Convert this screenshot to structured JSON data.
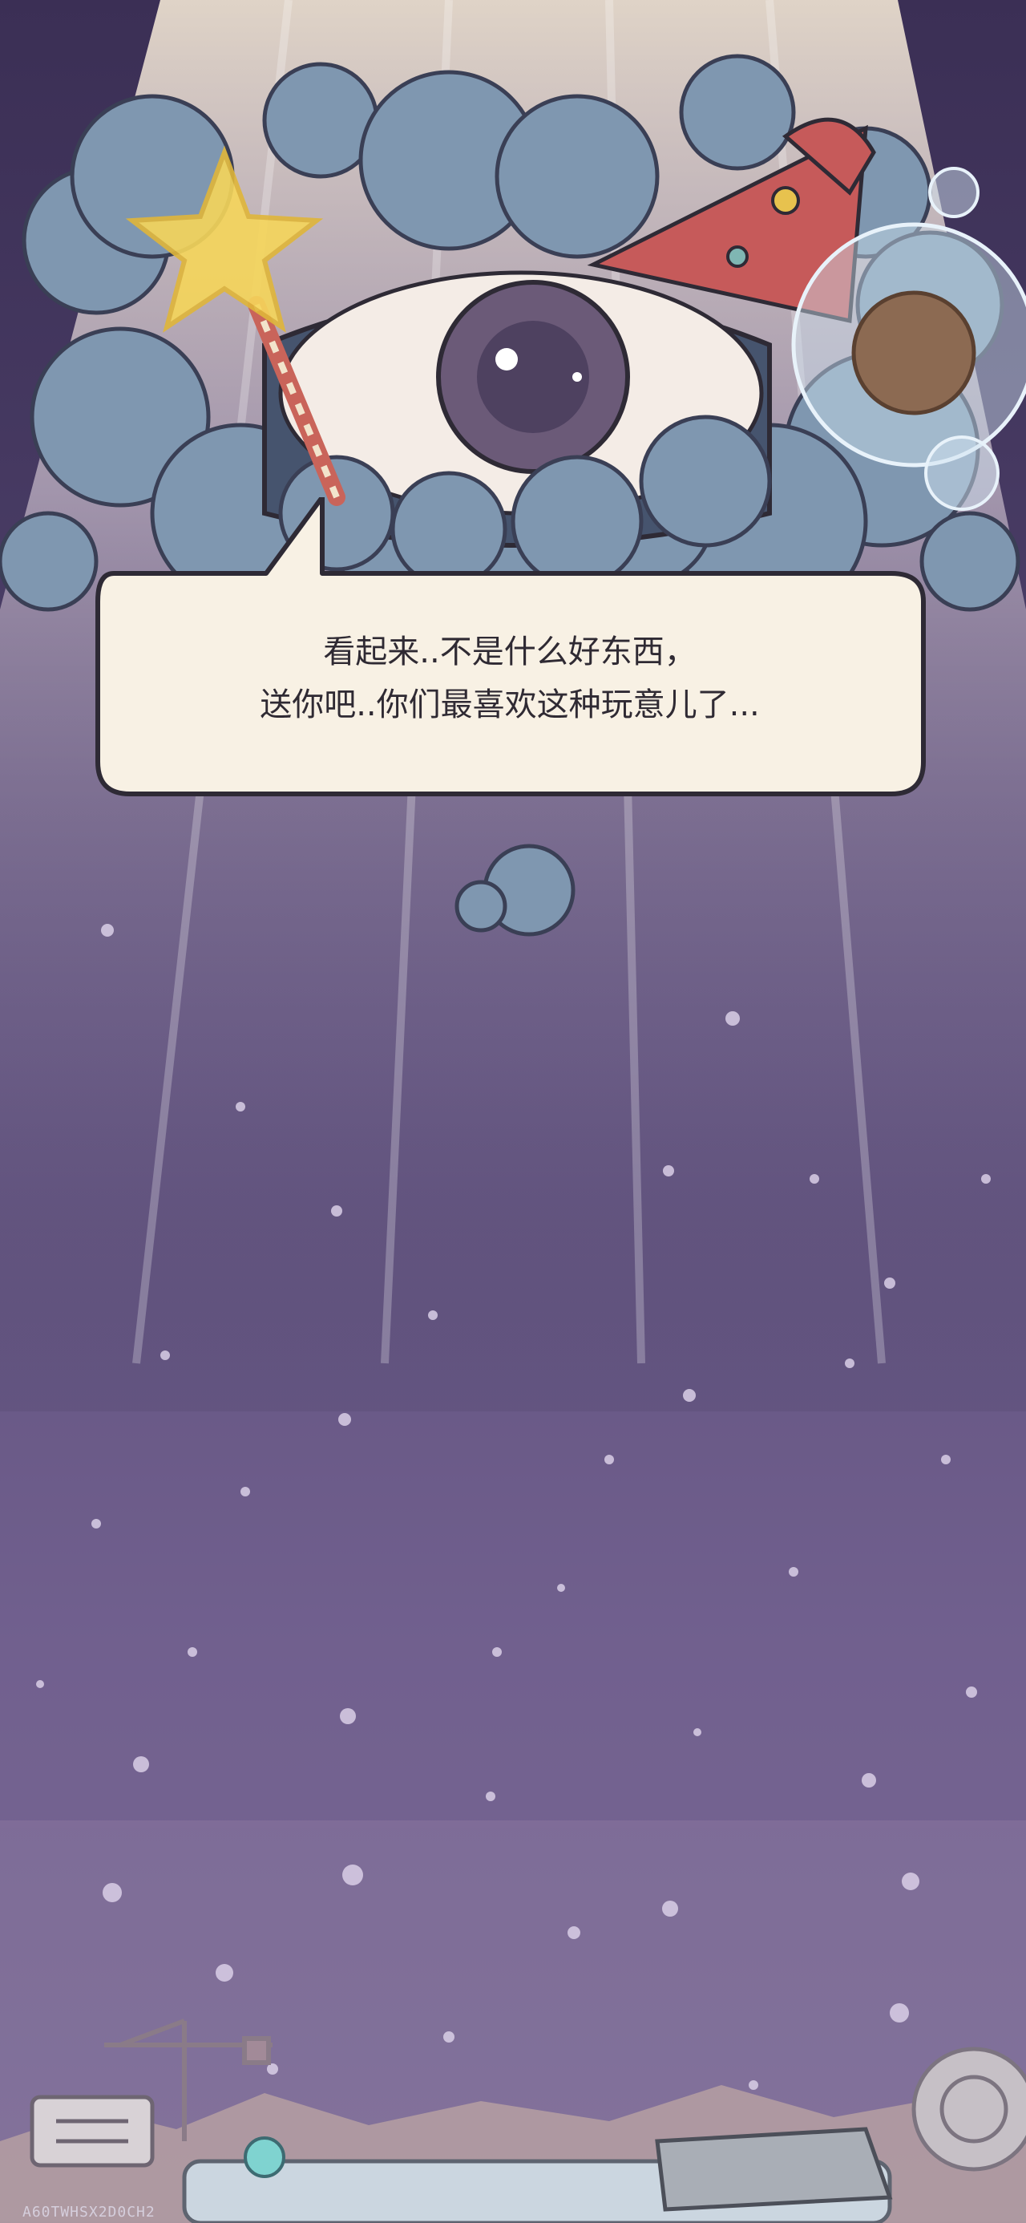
{
  "dialogue": {
    "line1": "看起来..不是什么好东西，",
    "line2": "送你吧..你们最喜欢这种玩意儿了..."
  },
  "watermark": "A60TWHSX2D0CH2",
  "colors": {
    "sky_top": "#3b2f55",
    "sky_bottom": "#7a6b94",
    "bubble_fill": "#f8f1e4",
    "bubble_outline": "#2e2a35",
    "cloud": "#7f97b0",
    "eye_iris": "#6b5a78",
    "star": "#f6d65a"
  },
  "icons": {
    "monster": "one-eyed-cloud-creature-icon",
    "wand": "star-wand-icon",
    "bubble": "floating-bubble-icon",
    "crane": "crane-icon",
    "sign": "signboard-icon",
    "pedestal": "stone-pedestal-icon",
    "shell": "snail-shell-icon"
  }
}
